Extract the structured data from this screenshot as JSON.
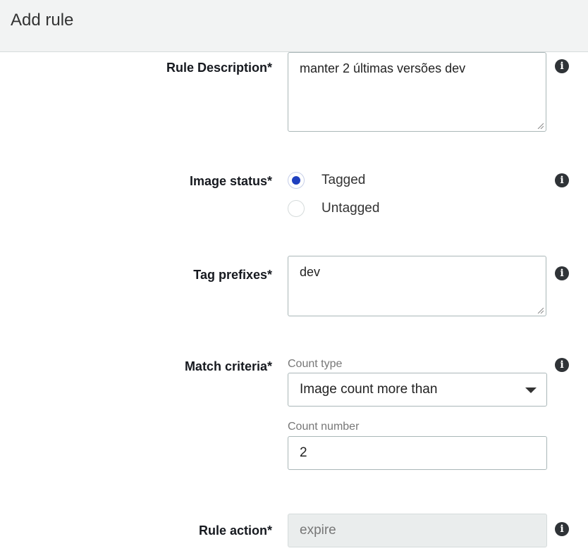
{
  "header": {
    "title": "Add rule"
  },
  "form": {
    "description": {
      "label": "Rule Description*",
      "value": "manter 2 últimas versões dev"
    },
    "image_status": {
      "label": "Image status*",
      "options": [
        {
          "label": "Tagged",
          "selected": true
        },
        {
          "label": "Untagged",
          "selected": false
        }
      ]
    },
    "tag_prefixes": {
      "label": "Tag prefixes*",
      "value": "dev"
    },
    "match_criteria": {
      "label": "Match criteria*",
      "count_type_label": "Count type",
      "count_type_value": "Image count more than",
      "count_number_label": "Count number",
      "count_number_value": "2"
    },
    "rule_action": {
      "label": "Rule action*",
      "value": "expire"
    }
  },
  "icons": {
    "info": "info-icon",
    "dropdown": "caret-down-icon",
    "resize": "resize-grip-icon"
  },
  "colors": {
    "radio_selected": "#1f40bf",
    "header_bg": "#f2f3f3",
    "info_icon": "#2f3337"
  }
}
